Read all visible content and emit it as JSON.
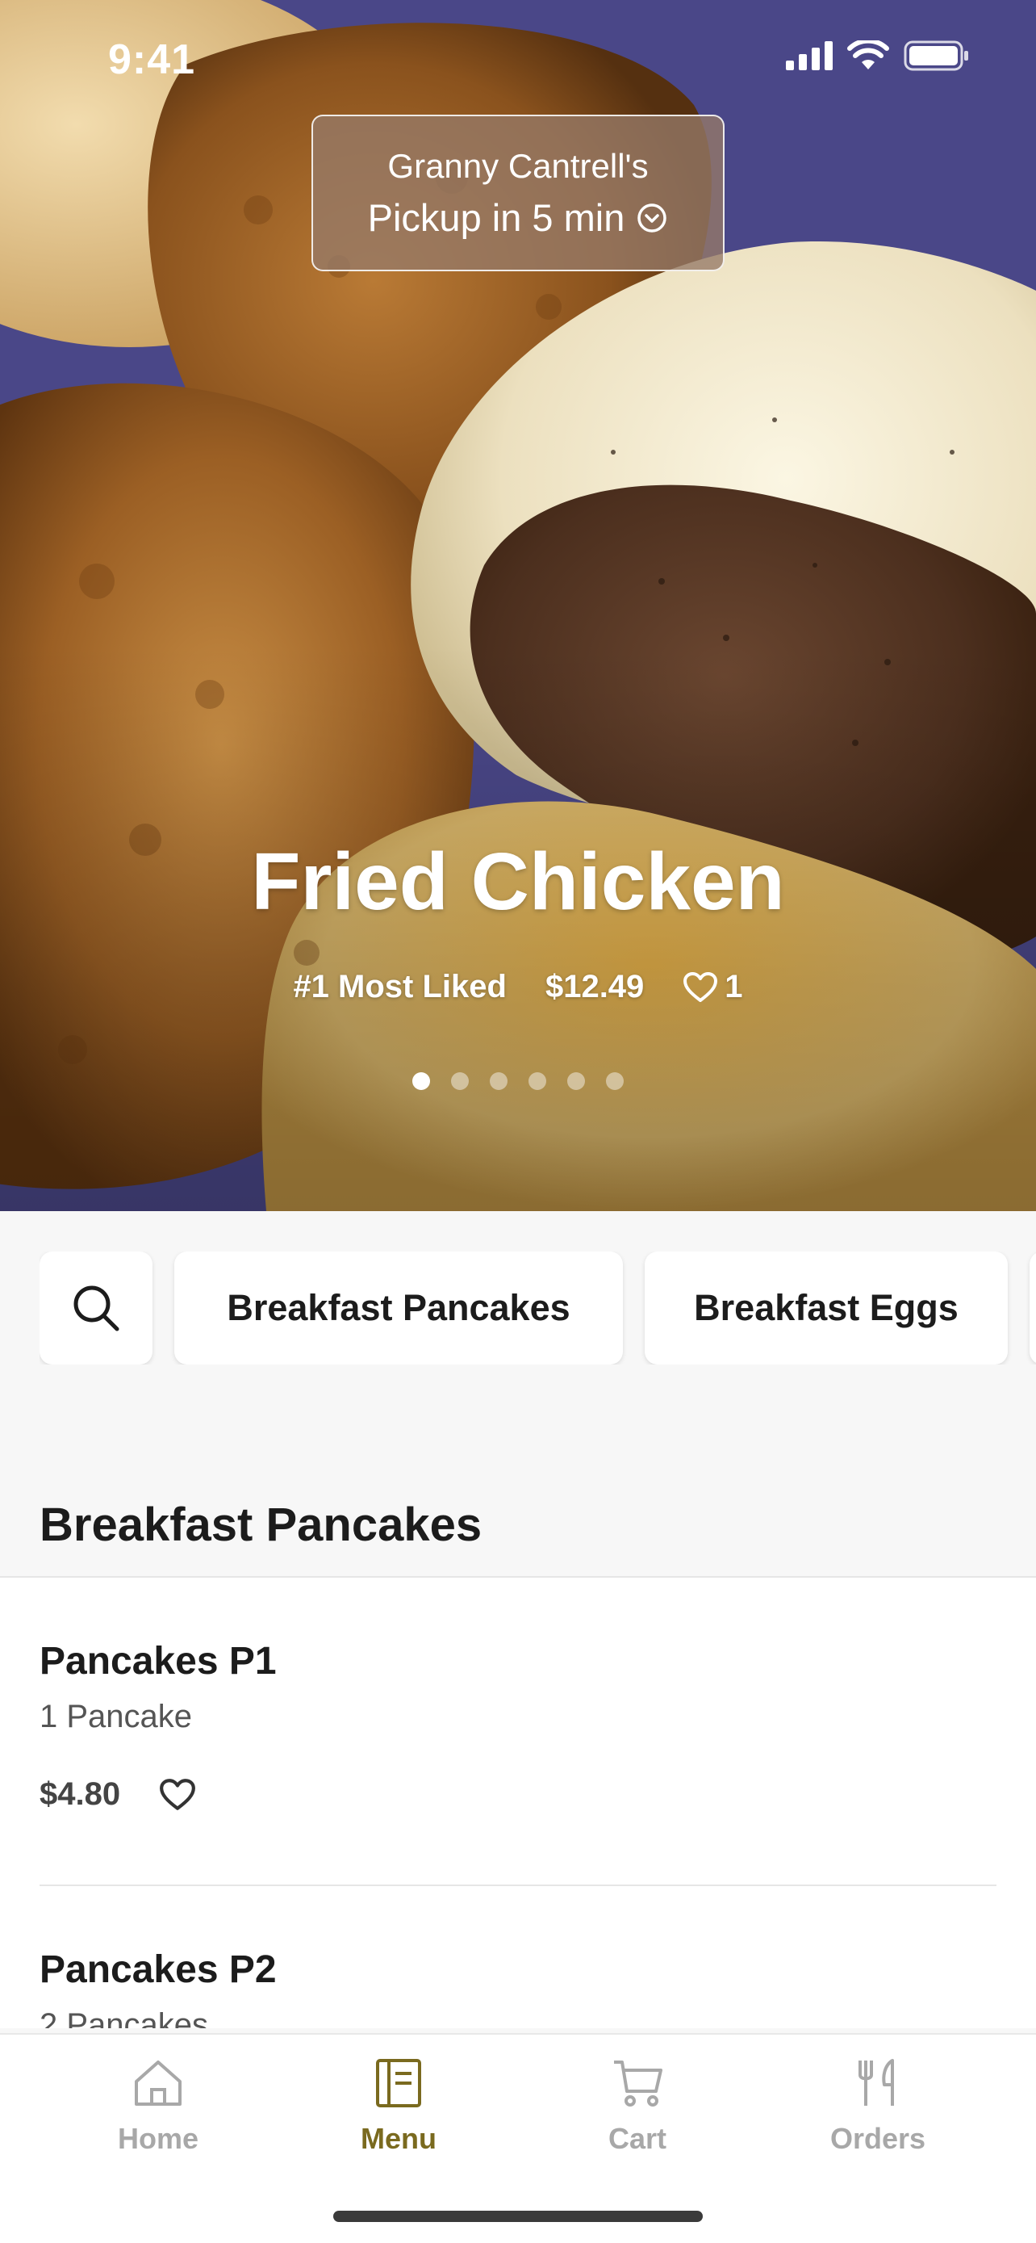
{
  "status_bar": {
    "time": "9:41"
  },
  "store": {
    "name": "Granny Cantrell's",
    "pickup": "Pickup in 5 min"
  },
  "hero": {
    "title": "Fried Chicken",
    "badge": "#1 Most Liked",
    "price": "$12.49",
    "likes": "1",
    "carousel": {
      "count": 6,
      "active_index": 0
    }
  },
  "categories": [
    "Breakfast Pancakes",
    "Breakfast Eggs"
  ],
  "section": {
    "title": "Breakfast Pancakes",
    "items": [
      {
        "name": "Pancakes P1",
        "description": "1 Pancake",
        "price": "$4.80"
      },
      {
        "name": "Pancakes P2",
        "description": "2 Pancakes",
        "price": ""
      }
    ]
  },
  "tabbar": {
    "tabs": [
      {
        "label": "Home",
        "icon": "home-icon"
      },
      {
        "label": "Menu",
        "icon": "menu-icon"
      },
      {
        "label": "Cart",
        "icon": "cart-icon"
      },
      {
        "label": "Orders",
        "icon": "utensils-icon"
      }
    ],
    "active": "Menu"
  },
  "colors": {
    "accent": "#7a6a1f",
    "inactive_tab": "#a8a8a8",
    "pill_bg": "#967a68"
  }
}
